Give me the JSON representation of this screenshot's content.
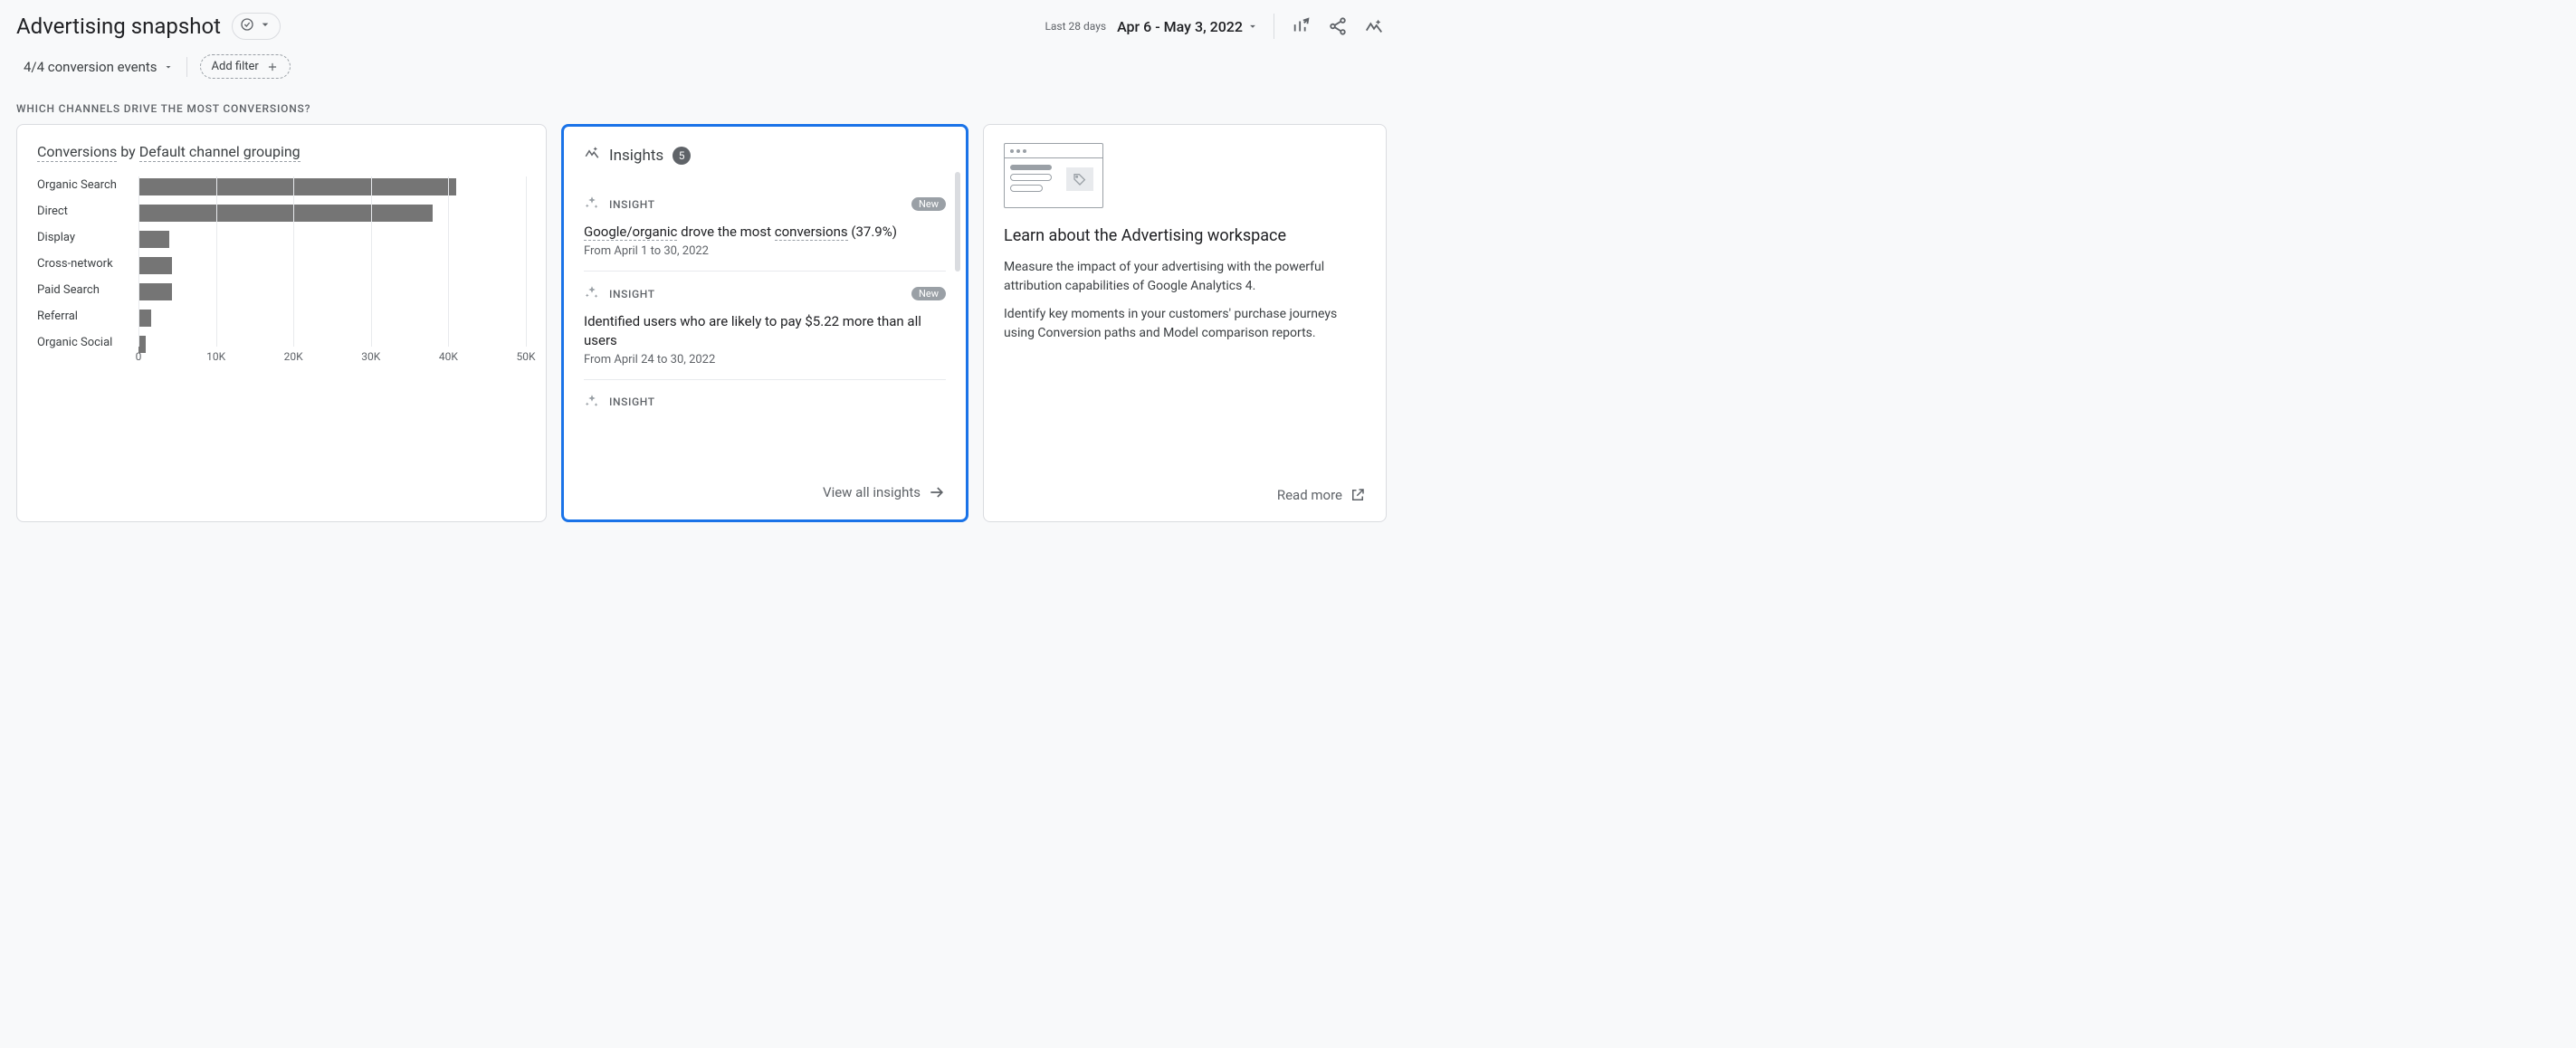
{
  "header": {
    "title": "Advertising snapshot",
    "date_label": "Last 28 days",
    "date_range": "Apr 6 - May 3, 2022"
  },
  "filters": {
    "conversion_events": "4/4 conversion events",
    "add_filter": "Add filter"
  },
  "section_title": "WHICH CHANNELS DRIVE THE MOST CONVERSIONS?",
  "chart_data": {
    "type": "bar",
    "title_prefix": "Conversions",
    "title_by": " by ",
    "title_suffix": "Default channel grouping",
    "categories": [
      "Organic Search",
      "Direct",
      "Display",
      "Cross-network",
      "Paid Search",
      "Referral",
      "Organic Social"
    ],
    "values": [
      41000,
      38000,
      4000,
      4300,
      4300,
      1600,
      900
    ],
    "xmax": 50000,
    "xticks": [
      0,
      10000,
      20000,
      30000,
      40000,
      50000
    ],
    "xtick_labels": [
      "0",
      "10K",
      "20K",
      "30K",
      "40K",
      "50K"
    ]
  },
  "insights": {
    "heading": "Insights",
    "count": "5",
    "label": "INSIGHT",
    "new": "New",
    "view_all": "View all insights",
    "items": [
      {
        "title_pre": "Google/organic",
        "title_mid": " drove the most ",
        "title_post": "conversions",
        "title_tail": " (37.9%)",
        "sub": "From April 1 to 30, 2022",
        "is_new": true
      },
      {
        "title_plain": "Identified users who are likely to pay $5.22 more than all users",
        "sub": "From April 24 to 30, 2022",
        "is_new": true
      },
      {
        "stub": true
      }
    ]
  },
  "learn": {
    "title": "Learn about the Advertising workspace",
    "p1": "Measure the impact of your advertising with the powerful attribution capabilities of Google Analytics 4.",
    "p2": "Identify key moments in your customers' purchase journeys using Conversion paths and Model comparison reports.",
    "read_more": "Read more"
  }
}
